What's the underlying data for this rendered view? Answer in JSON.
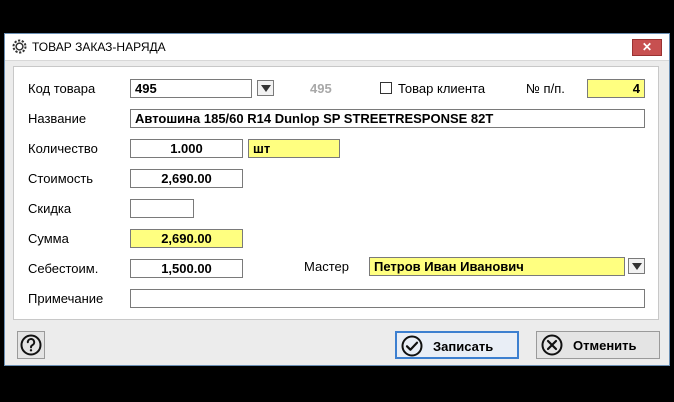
{
  "window": {
    "title": "ТОВАР ЗАКАЗ-НАРЯДА",
    "close_label": "✕"
  },
  "form": {
    "code_label": "Код товара",
    "code_value": "495",
    "code_echo": "495",
    "client_item_label": "Товар клиента",
    "client_item_checked": false,
    "pos_label": "№ п/п.",
    "pos_value": "4",
    "name_label": "Название",
    "name_value": "Автошина 185/60 R14 Dunlop SP STREETRESPONSE 82T",
    "qty_label": "Количество",
    "qty_value": "1.000",
    "unit_value": "шт",
    "cost_label": "Стоимость",
    "cost_value": "2,690.00",
    "discount_label": "Скидка",
    "discount_value": "",
    "sum_label": "Сумма",
    "sum_value": "2,690.00",
    "selfcost_label": "Себестоим.",
    "selfcost_value": "1,500.00",
    "master_label": "Мастер",
    "master_value": "Петров Иван Иванович",
    "note_label": "Примечание",
    "note_value": ""
  },
  "buttons": {
    "save_label": "Записать",
    "cancel_label": "Отменить"
  },
  "colors": {
    "highlight": "#ffff80",
    "accent": "#3c7fd0",
    "close": "#c75050"
  }
}
